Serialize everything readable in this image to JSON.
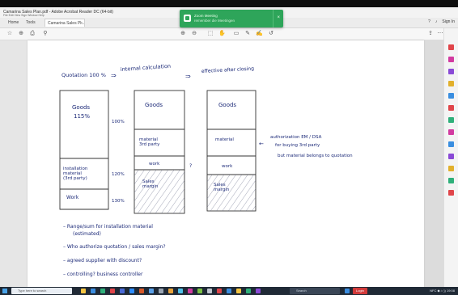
{
  "window": {
    "title": "Camarina Sales Plan.pdf - Adobe Acrobat Reader DC (64-bit)",
    "menus": "File  Edit  View  Sign  Window  Help"
  },
  "tabs": {
    "home": "Home",
    "tools": "Tools",
    "doc": "Camarina Sales Pl...",
    "sign_in": "Sign In"
  },
  "toast": {
    "line1": "Zoom Meeting",
    "line2": "remember die Meetingen"
  },
  "handwriting": {
    "header1": "Quotation 100 %",
    "header2": "internal calculation",
    "header3": "effective after closing",
    "arrow1": "⇒",
    "arrow2": "⇒",
    "box1_goods": "Goods",
    "box1_pct": "115%",
    "box1_install": "installation material (3rd party)",
    "box1_work": "Work",
    "box2_goods": "Goods",
    "box2_material": "material 3rd party",
    "box2_work": "work",
    "box2_sales": "Sales margin",
    "box3_goods": "Goods",
    "box3_material": "material",
    "box3_work": "work",
    "box3_sales": "Sales margin",
    "pct_a": "100%",
    "pct_b": "120%",
    "pct_c": "130%",
    "mark_q": "?",
    "note_arrow": "←",
    "note1": "authorization EM / DSA",
    "note2": "for buying 3rd party",
    "note3": "but material belongs to quotation",
    "bullet1a": "Range/sum for installation material",
    "bullet1b": "(estimated)",
    "bullet2": "Who authorize quotation / sales margin?",
    "bullet3": "agreed supplier with discount?",
    "bullet4": "controlling? business controller"
  },
  "taskbar": {
    "search_placeholder": "Type here to search",
    "search2": "Search",
    "login": "Login",
    "tray": "NFC  ◆  ⌂  ))  19:08"
  }
}
